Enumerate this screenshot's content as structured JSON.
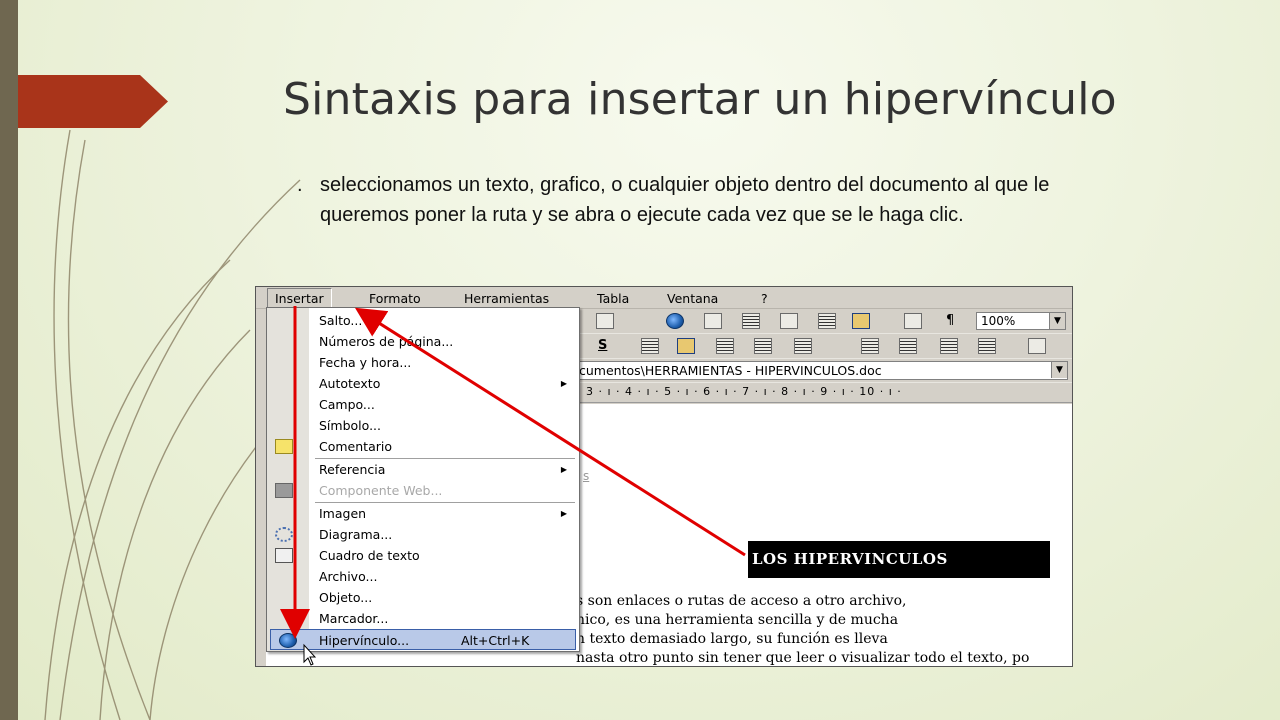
{
  "slide": {
    "title": "Sintaxis para insertar un hipervínculo",
    "bullet_marker": ".",
    "bullet_text": "seleccionamos un texto, grafico, o cualquier objeto dentro del documento al que le queremos poner la ruta y se abra o ejecute cada vez que se le haga clic."
  },
  "colors": {
    "accent": "#a9341a",
    "left_bar": "#6f6750",
    "background": "#eef3de",
    "arrow": "#e00000"
  },
  "screenshot": {
    "menubar": [
      "Insertar",
      "Formato",
      "Herramientas",
      "Tabla",
      "Ventana",
      "?"
    ],
    "zoom": "100%",
    "path": "cumentos\\HERRAMIENTAS - HIPERVINCULOS.doc",
    "ruler": "3 · ı · 4 · ı · 5 · ı · 6 · ı · 7 · ı · 8 · ı · 9 · ı · 10 · ı ·",
    "format_label": "S",
    "faint_text": "s",
    "banner": "LOS HIPERVINCULOS",
    "body_lines": [
      "s son enlaces o rutas de acceso a otro archivo,",
      "nico, es una herramienta sencilla y de mucha",
      "n texto demasiado largo, su función es lleva",
      "nasta otro punto sin tener que leer o visualizar todo el texto, po"
    ],
    "menu_items": [
      {
        "label": "Salto...",
        "icon": "none"
      },
      {
        "label": "Números de página...",
        "icon": "none"
      },
      {
        "label": "Fecha y hora...",
        "icon": "none"
      },
      {
        "label": "Autotexto",
        "icon": "none",
        "submenu": "▶"
      },
      {
        "label": "Campo...",
        "icon": "none"
      },
      {
        "label": "Símbolo...",
        "icon": "none"
      },
      {
        "label": "Comentario",
        "icon": "comment-icon"
      },
      {
        "label": "Referencia",
        "icon": "none",
        "submenu": "▶"
      },
      {
        "label": "Componente Web...",
        "icon": "web-component-icon",
        "disabled": true
      },
      {
        "label": "Imagen",
        "icon": "none",
        "submenu": "▶"
      },
      {
        "label": "Diagrama...",
        "icon": "diagram-icon"
      },
      {
        "label": "Cuadro de texto",
        "icon": "textbox-icon"
      },
      {
        "label": "Archivo...",
        "icon": "none"
      },
      {
        "label": "Objeto...",
        "icon": "none"
      },
      {
        "label": "Marcador...",
        "icon": "none"
      },
      {
        "label": "Hipervínculo...",
        "icon": "hyperlink-globe-icon",
        "shortcut": "Alt+Ctrl+K",
        "highlighted": true
      }
    ]
  }
}
